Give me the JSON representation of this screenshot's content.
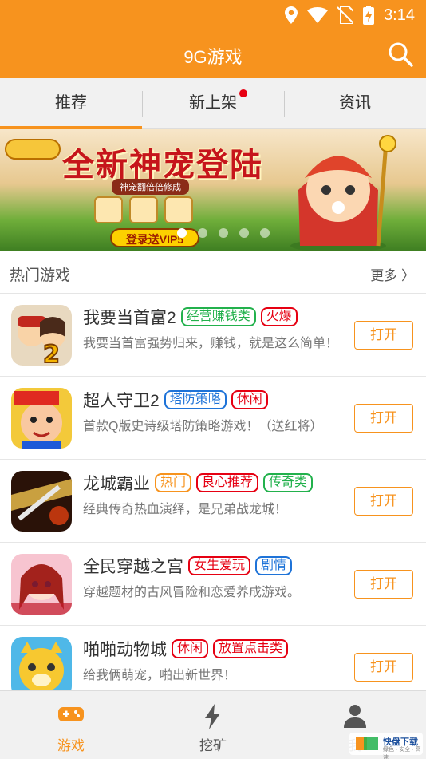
{
  "status_bar": {
    "time": "3:14"
  },
  "app_bar": {
    "title": "9G游戏",
    "search_icon": "search-icon"
  },
  "tabs": [
    {
      "label": "推荐",
      "active": true
    },
    {
      "label": "新上架",
      "badge": "red-dot"
    },
    {
      "label": "资讯"
    }
  ],
  "banner": {
    "headline": "全新神宠登陆",
    "subline": "神宠翻倍倍修成",
    "cta": "登录送VIP5",
    "slides": 5,
    "active_slide": 0
  },
  "section": {
    "title": "热门游戏",
    "more": "更多 〉"
  },
  "colors": {
    "accent": "#f7931e",
    "tab_badge": "#e60012"
  },
  "games": [
    {
      "name": "我要当首富2",
      "tags": [
        {
          "text": "经营赚钱类",
          "color": "#22b14c"
        },
        {
          "text": "火爆",
          "color": "#e60012"
        }
      ],
      "desc": "我要当首富强势归来，赚钱，就是这么简单！",
      "button": "打开",
      "icon": "game-icon-rich-2"
    },
    {
      "name": "超人守卫2",
      "tags": [
        {
          "text": "塔防策略",
          "color": "#1e73d8"
        },
        {
          "text": "休闲",
          "color": "#e60012"
        }
      ],
      "desc": "首款Q版史诗级塔防策略游戏！（送红将）",
      "button": "打开",
      "icon": "game-icon-superman"
    },
    {
      "name": "龙城霸业",
      "tags": [
        {
          "text": "热门",
          "color": "#f7931e"
        },
        {
          "text": "良心推荐",
          "color": "#e60012"
        },
        {
          "text": "传奇类",
          "color": "#22b14c"
        }
      ],
      "desc": "经典传奇热血演绎，是兄弟战龙城！",
      "button": "打开",
      "icon": "game-icon-dragon-city"
    },
    {
      "name": "全民穿越之宫",
      "tags": [
        {
          "text": "女生爱玩",
          "color": "#e60012"
        },
        {
          "text": "剧情",
          "color": "#1e73d8"
        }
      ],
      "desc": "穿越题材的古风冒险和恋爱养成游戏。",
      "button": "打开",
      "icon": "game-icon-palace"
    },
    {
      "name": "啪啪动物城",
      "tags": [
        {
          "text": "休闲",
          "color": "#e60012"
        },
        {
          "text": "放置点击类",
          "color": "#e60012"
        }
      ],
      "desc": "给我俩萌宠，啪出新世界！",
      "button": "打开",
      "icon": "game-icon-animal-city"
    }
  ],
  "bottom_nav": [
    {
      "label": "游戏",
      "icon": "gamepad-icon",
      "active": true
    },
    {
      "label": "挖矿",
      "icon": "lightning-icon"
    },
    {
      "label": "我",
      "icon": "person-icon"
    }
  ],
  "watermark": {
    "text": "快盘下载",
    "sub": "绿色 · 安全 · 高速"
  }
}
